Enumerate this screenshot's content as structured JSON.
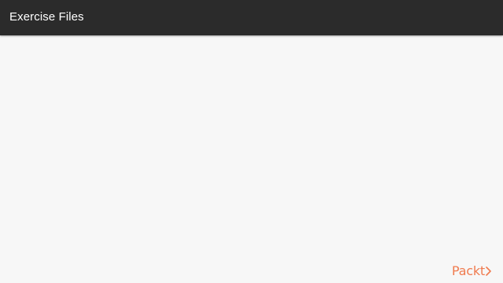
{
  "header": {
    "title": "Exercise Files"
  },
  "brand": {
    "name": "Packt",
    "icon": "chevron-right-icon",
    "color": "#f07b4f"
  },
  "colors": {
    "header_bg": "#2b2b2b",
    "page_bg": "#f7f7f7"
  }
}
